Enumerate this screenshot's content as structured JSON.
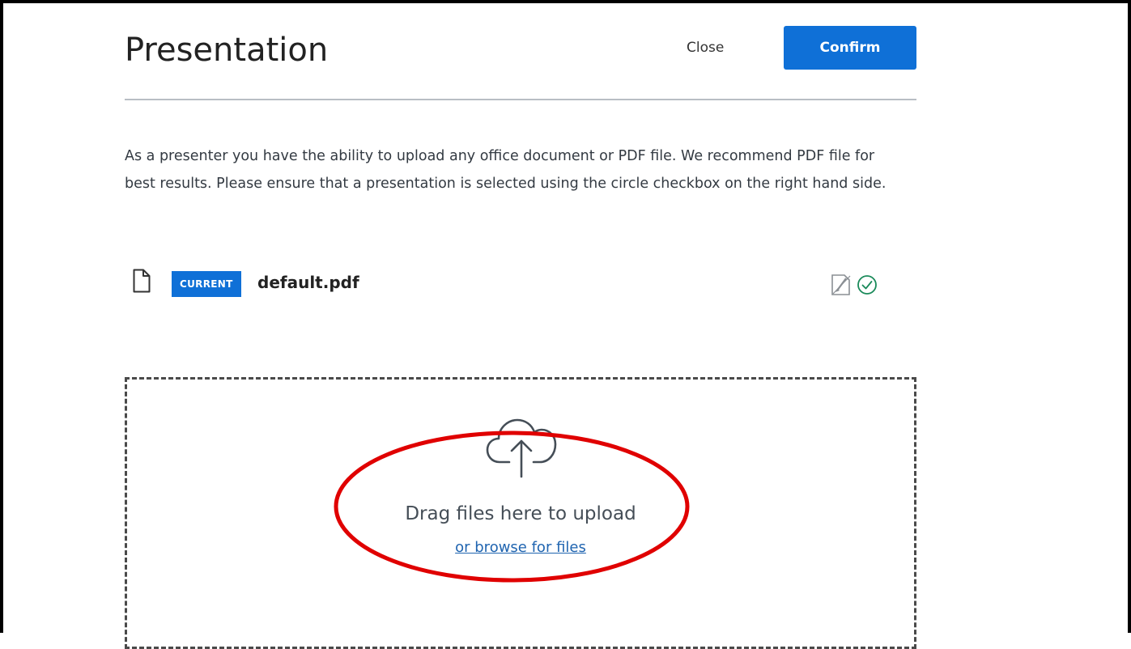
{
  "modal": {
    "title": "Presentation",
    "close_label": "Close",
    "confirm_label": "Confirm",
    "description": "As a presenter you have the ability to upload any office document or PDF file. We recommend PDF file for best results. Please ensure that a presentation is selected using the circle checkbox on the right hand side."
  },
  "files": [
    {
      "badge": "CURRENT",
      "name": "default.pdf",
      "icon": "file-icon",
      "actions": [
        "remove-icon",
        "check-circle-icon"
      ]
    }
  ],
  "dropzone": {
    "icon": "cloud-upload-icon",
    "text": "Drag files here to upload",
    "browse_label": "or browse for files"
  },
  "colors": {
    "accent": "#0f70d7",
    "link": "#1f64b0",
    "check": "#1a8a5a",
    "annotation": "#e00000"
  }
}
